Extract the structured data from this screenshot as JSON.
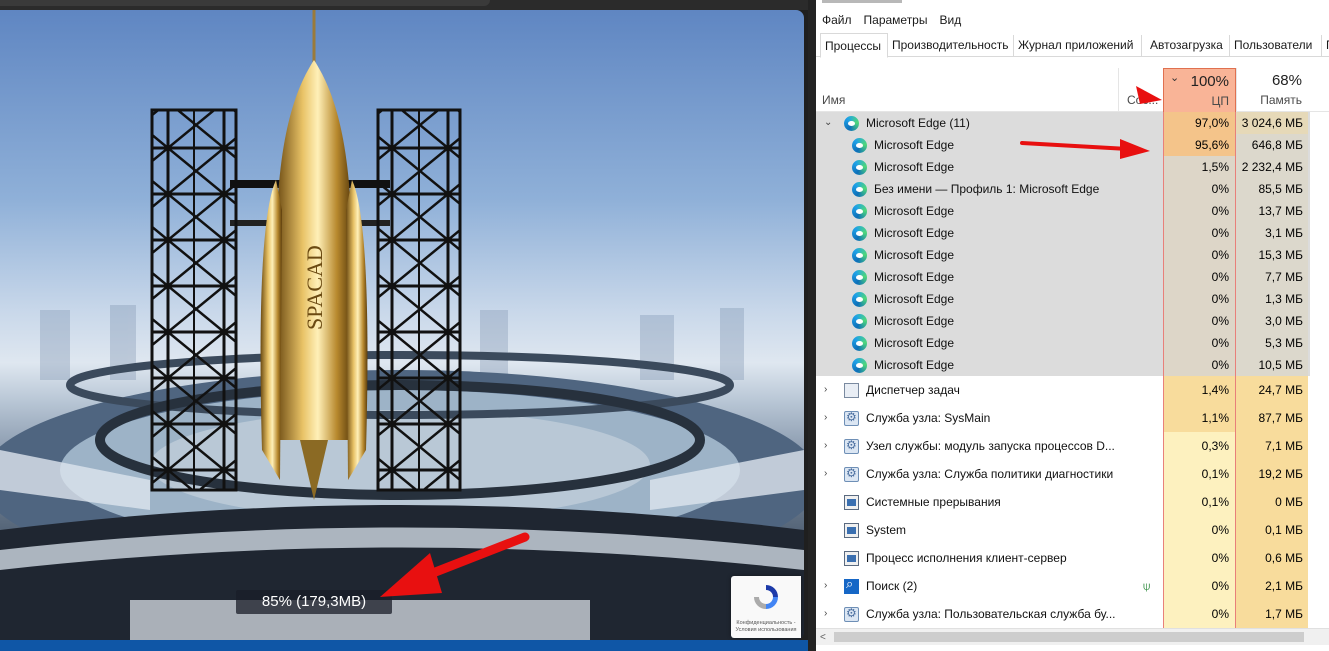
{
  "scene": {
    "loading_text": "85% (179,3MB)",
    "rocket_label": "SPACAD",
    "recaptcha_text": "Конфиденциальность - Условия использования"
  },
  "taskmgr": {
    "menu": [
      "Файл",
      "Параметры",
      "Вид"
    ],
    "tabs": [
      "Процессы",
      "Производительность",
      "Журнал приложений",
      "Автозагрузка",
      "Пользователи",
      "П"
    ],
    "header": {
      "name": "Имя",
      "status": "Сос...",
      "cpu_pct": "100%",
      "cpu_label": "ЦП",
      "mem_pct": "68%",
      "mem_label": "Память"
    },
    "rows": [
      {
        "name": "Microsoft Edge (11)",
        "cpu": "97,0%",
        "mem": "3 024,6 МБ",
        "icon": "edge-icon",
        "level": 0,
        "expand": "expanded",
        "group": true
      },
      {
        "name": "Microsoft Edge",
        "cpu": "95,6%",
        "mem": "646,8 МБ",
        "icon": "edge-icon",
        "level": 1,
        "group": true
      },
      {
        "name": "Microsoft Edge",
        "cpu": "1,5%",
        "mem": "2 232,4 МБ",
        "icon": "edge-icon",
        "level": 1,
        "group": true
      },
      {
        "name": "Без имени — Профиль 1: Microsoft Edge",
        "cpu": "0%",
        "mem": "85,5 МБ",
        "icon": "edge-icon",
        "level": 1,
        "group": true
      },
      {
        "name": "Microsoft Edge",
        "cpu": "0%",
        "mem": "13,7 МБ",
        "icon": "edge-icon",
        "level": 1,
        "group": true
      },
      {
        "name": "Microsoft Edge",
        "cpu": "0%",
        "mem": "3,1 МБ",
        "icon": "edge-icon",
        "level": 1,
        "group": true
      },
      {
        "name": "Microsoft Edge",
        "cpu": "0%",
        "mem": "15,3 МБ",
        "icon": "edge-icon",
        "level": 1,
        "group": true
      },
      {
        "name": "Microsoft Edge",
        "cpu": "0%",
        "mem": "7,7 МБ",
        "icon": "edge-icon",
        "level": 1,
        "group": true
      },
      {
        "name": "Microsoft Edge",
        "cpu": "0%",
        "mem": "1,3 МБ",
        "icon": "edge-icon",
        "level": 1,
        "group": true
      },
      {
        "name": "Microsoft Edge",
        "cpu": "0%",
        "mem": "3,0 МБ",
        "icon": "edge-icon",
        "level": 1,
        "group": true
      },
      {
        "name": "Microsoft Edge",
        "cpu": "0%",
        "mem": "5,3 МБ",
        "icon": "edge-icon",
        "level": 1,
        "group": true
      },
      {
        "name": "Microsoft Edge",
        "cpu": "0%",
        "mem": "10,5 МБ",
        "icon": "edge-icon",
        "level": 1,
        "group": true
      },
      {
        "name": "Диспетчер задач",
        "cpu": "1,4%",
        "mem": "24,7 МБ",
        "icon": "app-icon",
        "level": 0,
        "expand": "collapsed"
      },
      {
        "name": "Служба узла: SysMain",
        "cpu": "1,1%",
        "mem": "87,7 МБ",
        "icon": "gear-icon",
        "level": 0,
        "expand": "collapsed"
      },
      {
        "name": "Узел службы: модуль запуска процессов D...",
        "cpu": "0,3%",
        "mem": "7,1 МБ",
        "icon": "gear-icon",
        "level": 0,
        "expand": "collapsed"
      },
      {
        "name": "Служба узла: Служба политики диагностики",
        "cpu": "0,1%",
        "mem": "19,2 МБ",
        "icon": "gear-icon",
        "level": 0,
        "expand": "collapsed"
      },
      {
        "name": "Системные прерывания",
        "cpu": "0,1%",
        "mem": "0 МБ",
        "icon": "system-icon",
        "level": 0
      },
      {
        "name": "System",
        "cpu": "0%",
        "mem": "0,1 МБ",
        "icon": "system-icon",
        "level": 0
      },
      {
        "name": "Процесс исполнения клиент-сервер",
        "cpu": "0%",
        "mem": "0,6 МБ",
        "icon": "system-icon",
        "level": 0
      },
      {
        "name": "Поиск (2)",
        "cpu": "0%",
        "mem": "2,1 МБ",
        "icon": "search-icon",
        "level": 0,
        "expand": "collapsed",
        "leaf": true
      },
      {
        "name": "Служба узла: Пользовательская служба бу...",
        "cpu": "0%",
        "mem": "1,7 МБ",
        "icon": "gear-icon",
        "level": 0,
        "expand": "collapsed"
      }
    ]
  },
  "colors": {
    "cpu_header": "#f9b497",
    "heat_high": "#f4c48a",
    "heat_mid": "#f8dc9c",
    "heat_low": "#fdf1bf",
    "annotation_red": "#e81010"
  }
}
